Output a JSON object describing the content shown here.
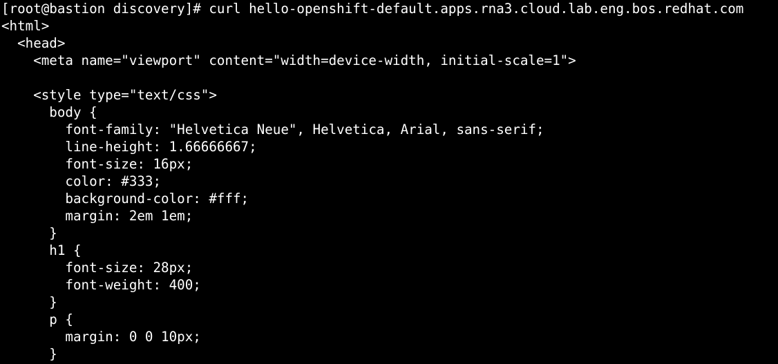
{
  "terminal": {
    "foreground": "#ffffff",
    "background": "#000000",
    "lines": [
      "[root@bastion discovery]# curl hello-openshift-default.apps.rna3.cloud.lab.eng.bos.redhat.com",
      "<html>",
      "  <head>",
      "    <meta name=\"viewport\" content=\"width=device-width, initial-scale=1\">",
      "",
      "    <style type=\"text/css\">",
      "      body {",
      "        font-family: \"Helvetica Neue\", Helvetica, Arial, sans-serif;",
      "        line-height: 1.66666667;",
      "        font-size: 16px;",
      "        color: #333;",
      "        background-color: #fff;",
      "        margin: 2em 1em;",
      "      }",
      "      h1 {",
      "        font-size: 28px;",
      "        font-weight: 400;",
      "      }",
      "      p {",
      "        margin: 0 0 10px;",
      "      }"
    ]
  }
}
